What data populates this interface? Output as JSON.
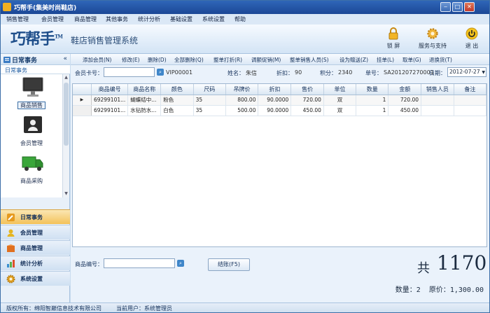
{
  "window": {
    "title": "巧帮手(集美时尚鞋店)"
  },
  "menu": [
    "销售管理",
    "会员管理",
    "商品管理",
    "其他事务",
    "统计分析",
    "基础设置",
    "系统设置",
    "帮助"
  ],
  "brand": {
    "logo": "巧帮手",
    "tm": "TM",
    "subtitle": "鞋店销售管理系统"
  },
  "topbuttons": [
    {
      "label": "锁 屏",
      "icon": "lock-icon"
    },
    {
      "label": "服务与支持",
      "icon": "gear-icon"
    },
    {
      "label": "退 出",
      "icon": "power-icon"
    }
  ],
  "sidebar": {
    "header": "日常事务",
    "collapse": "«",
    "subheader": "日常事务",
    "items": [
      {
        "label": "商品销售",
        "icon": "monitor-icon"
      },
      {
        "label": "会员管理",
        "icon": "member-card-icon"
      },
      {
        "label": "商品采购",
        "icon": "truck-icon"
      }
    ],
    "nav": [
      {
        "label": "日常事务",
        "icon": "pencil-icon",
        "color": "#e69a1f"
      },
      {
        "label": "会员管理",
        "icon": "member-icon",
        "color": "#e5b520"
      },
      {
        "label": "商品管理",
        "icon": "box-icon",
        "color": "#e07020"
      },
      {
        "label": "统计分析",
        "icon": "chart-icon",
        "color": "#3a8fd0"
      },
      {
        "label": "系统设置",
        "icon": "settings-icon",
        "color": "#e0a020"
      }
    ]
  },
  "toolbar": [
    "添加会员(N)",
    "修改(E)",
    "删除(D)",
    "全部删除(Q)",
    "整单打折(R)",
    "调额促销(M)",
    "整单销售人员(S)",
    "设为赠送(Z)",
    "挂单(L)",
    "取单(G)",
    "退换货(T)"
  ],
  "info": {
    "card_label": "会员卡号：",
    "card_value": "",
    "vip_code": "VIP00001",
    "name_label": "姓名：",
    "name_value": "朱信",
    "discount_label": "折扣：",
    "discount_value": "90",
    "points_label": "积分：",
    "points_value": "2340",
    "order_label": "单号：",
    "order_value": "SA201207270001",
    "date_label": "日期：",
    "date_value": "2012-07-27"
  },
  "table": {
    "columns": [
      "商品编号",
      "商品名称",
      "颜色",
      "尺码",
      "吊牌价",
      "折扣",
      "售价",
      "单位",
      "数量",
      "金额",
      "销售人员",
      "备注"
    ],
    "rows": [
      [
        "69299101...",
        "蝴蝶结中...",
        "粉色",
        "35",
        "800.00",
        "90.0000",
        "720.00",
        "双",
        "1",
        "720.00",
        "",
        ""
      ],
      [
        "69299101...",
        "水钻防水...",
        "白色",
        "35",
        "500.00",
        "90.0000",
        "450.00",
        "双",
        "1",
        "450.00",
        "",
        ""
      ]
    ]
  },
  "bottom": {
    "product_label": "商品编号：",
    "product_value": "",
    "checkout": "结账(F5)",
    "total_prefix": "共",
    "total": "1170",
    "qty_label": "数量：",
    "qty_value": "2",
    "orig_label": "原价：",
    "orig_value": "1,300.00"
  },
  "status": {
    "copyright": "版权所有：绵阳智巅信息技术有限公司",
    "user": "当前用户：系统管理员"
  }
}
